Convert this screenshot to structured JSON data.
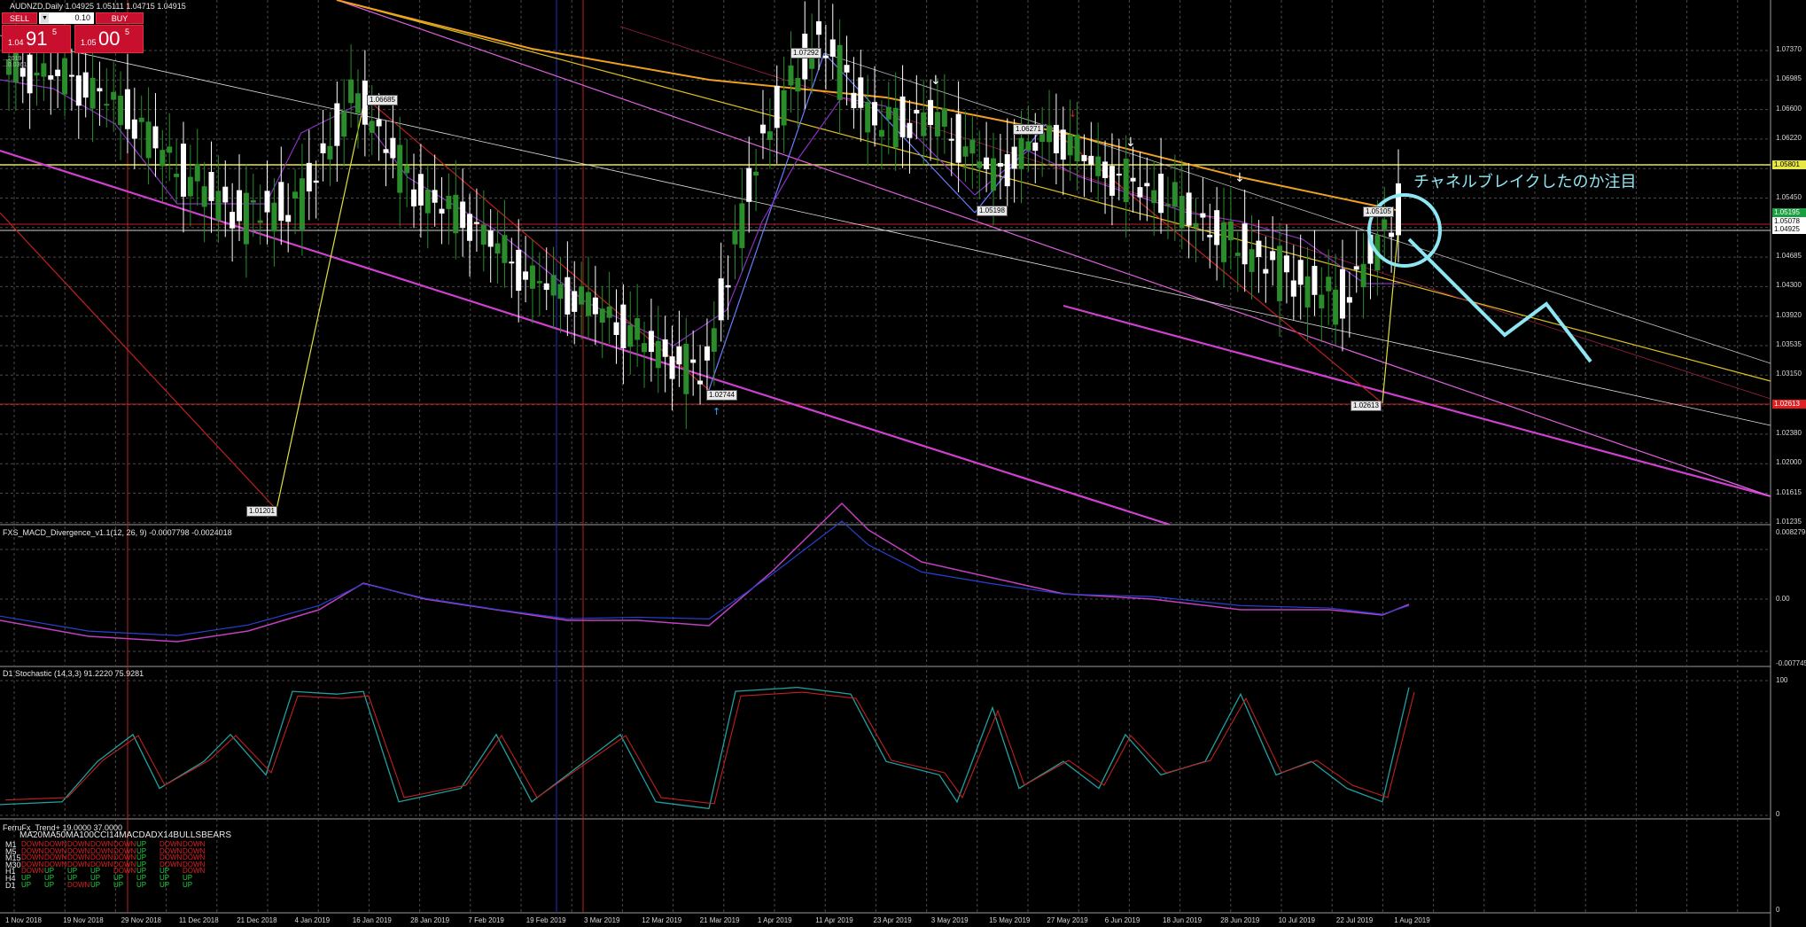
{
  "symbol_header": "AUDNZD,Daily  1.04925 1.05111 1.04715 1.04915",
  "trade_panel": {
    "sell_label": "SELL",
    "buy_label": "BUY",
    "lots": "0.10",
    "sell_price_prefix": "1.04",
    "sell_price_big": "91",
    "sell_price_sup": "5",
    "buy_price_prefix": "1.05",
    "buy_price_big": "00",
    "buy_price_sup": "5",
    "info_line1": "...2019",
    "info_line2": "...0.0361"
  },
  "annotation_jp": "チャネルブレイクしたのか注目",
  "colors": {
    "background": "#000000",
    "grid": "#4a4a4a",
    "bull_candle": "#ffffff",
    "bear_candle": "#2a8c2a",
    "ma_orange": "#f0a020",
    "channel_magenta": "#d040d0",
    "horizontal_yellow": "#e8e840",
    "annotation_cyan": "#8ee6f2",
    "support_red": "#c02020"
  },
  "main_panel": {
    "y_axis_labels": [
      "1.07370",
      "1.06985",
      "1.06600",
      "1.06220",
      "1.05835",
      "1.05450",
      "1.05065",
      "1.04685",
      "1.04300",
      "1.03920",
      "1.03535",
      "1.03150",
      "1.02765",
      "1.02380",
      "1.02000",
      "1.01615",
      "1.01235"
    ],
    "tags": [
      {
        "label": "1.07292",
        "role": "swing-high"
      },
      {
        "label": "1.06685",
        "role": "swing-high"
      },
      {
        "label": "1.06271",
        "role": "swing-high"
      },
      {
        "label": "1.05198",
        "role": "swing-low"
      },
      {
        "label": "1.05105",
        "role": "swing-high"
      },
      {
        "label": "1.02744",
        "role": "swing-low"
      },
      {
        "label": "1.02613",
        "role": "swing-low"
      },
      {
        "label": "1.01201",
        "role": "swing-low"
      }
    ],
    "right_tags": [
      {
        "label": "1.05801",
        "color": "#e8e840",
        "text": "#000"
      },
      {
        "label": "1.05195",
        "color": "#18a040",
        "text": "#fff"
      },
      {
        "label": "1.05078",
        "color": "#ffffff",
        "text": "#000"
      },
      {
        "label": "1.04925",
        "color": "#ffffff",
        "text": "#000"
      },
      {
        "label": "1.02613",
        "color": "#e02020",
        "text": "#fff"
      }
    ]
  },
  "macd_panel": {
    "header": "FXS_MACD_Divergence_v1.1(12, 26, 9) -0.0007798 -0.0024018",
    "y_axis_labels": [
      "0.0082795",
      "0.00",
      "-0.0077455"
    ]
  },
  "stoch_panel": {
    "header": "D1 Stochastic (14,3,3) 91.2220 75.9281",
    "y_axis_labels": [
      "100",
      "0"
    ]
  },
  "trend_panel": {
    "header": "FerruFx_Trend+ 19.0000 37.0000",
    "columns": "MA20MA50MA100CCI14MACDADX14BULLSBEARS",
    "rows": [
      {
        "tf": "M1",
        "cells": [
          "DOWN",
          "DOWN",
          "DOWN",
          "DOWN",
          "DOWN",
          "UP",
          "DOWN",
          "DOWN"
        ]
      },
      {
        "tf": "M5",
        "cells": [
          "DOWN",
          "DOWN",
          "DOWN",
          "DOWN",
          "DOWN",
          "UP",
          "DOWN",
          "DOWN"
        ]
      },
      {
        "tf": "M15",
        "cells": [
          "DOWN",
          "DOWN",
          "DOWN",
          "DOWN",
          "DOWN",
          "UP",
          "DOWN",
          "DOWN"
        ]
      },
      {
        "tf": "M30",
        "cells": [
          "DOWN",
          "DOWN",
          "DOWN",
          "DOWN",
          "DOWN",
          "UP",
          "DOWN",
          "DOWN"
        ]
      },
      {
        "tf": "H1",
        "cells": [
          "DOWN",
          "UP",
          "UP",
          "UP",
          "DOWN",
          "UP",
          "UP",
          "DOWN"
        ]
      },
      {
        "tf": "H4",
        "cells": [
          "UP",
          "UP",
          "UP",
          "UP",
          "UP",
          "UP",
          "UP",
          "UP"
        ]
      },
      {
        "tf": "D1",
        "cells": [
          "UP",
          "UP",
          "DOWN",
          "UP",
          "UP",
          "UP",
          "UP",
          "UP"
        ]
      }
    ],
    "y_axis_labels": [
      "0"
    ]
  },
  "x_axis_labels": [
    "1 Nov 2018",
    "19 Nov 2018",
    "29 Nov 2018",
    "11 Dec 2018",
    "21 Dec 2018",
    "4 Jan 2019",
    "16 Jan 2019",
    "28 Jan 2019",
    "7 Feb 2019",
    "19 Feb 2019",
    "3 Mar 2019",
    "12 Mar 2019",
    "21 Mar 2019",
    "1 Apr 2019",
    "11 Apr 2019",
    "23 Apr 2019",
    "3 May 2019",
    "15 May 2019",
    "27 May 2019",
    "6 Jun 2019",
    "18 Jun 2019",
    "28 Jun 2019",
    "10 Jul 2019",
    "22 Jul 2019",
    "1 Aug 2019"
  ],
  "chart_data": {
    "type": "candlestick",
    "instrument": "AUDNZD",
    "timeframe": "Daily",
    "ohlc_header": {
      "open": 1.04925,
      "high": 1.05111,
      "low": 1.04715,
      "close": 1.04915
    },
    "ylim": [
      1.0105,
      1.0755
    ],
    "dates": [
      "1 Nov 2018",
      "19 Nov 2018",
      "29 Nov 2018",
      "11 Dec 2018",
      "21 Dec 2018",
      "4 Jan 2019",
      "16 Jan 2019",
      "28 Jan 2019",
      "7 Feb 2019",
      "19 Feb 2019",
      "3 Mar 2019",
      "12 Mar 2019",
      "21 Mar 2019",
      "1 Apr 2019",
      "11 Apr 2019",
      "23 Apr 2019",
      "3 May 2019",
      "15 May 2019",
      "27 May 2019",
      "6 Jun 2019",
      "18 Jun 2019",
      "28 Jun 2019",
      "10 Jul 2019",
      "22 Jul 2019",
      "1 Aug 2019"
    ],
    "price_path_approx": [
      1.067,
      1.066,
      1.062,
      1.054,
      1.049,
      1.05,
      1.064,
      1.052,
      1.048,
      1.041,
      1.038,
      1.033,
      1.029,
      1.058,
      1.071,
      1.06,
      1.061,
      1.054,
      1.059,
      1.054,
      1.051,
      1.046,
      1.042,
      1.038,
      1.049
    ],
    "swing_points": [
      1.07292,
      1.06685,
      1.06271,
      1.05198,
      1.05105,
      1.02744,
      1.02613,
      1.01201
    ],
    "horizontal_levels": [
      1.05801,
      1.05078,
      1.04925,
      1.02613
    ],
    "stochastic_last": {
      "k": 91.222,
      "d": 75.9281
    },
    "macd_last": {
      "main": -0.0007798,
      "signal": -0.0024018
    }
  }
}
